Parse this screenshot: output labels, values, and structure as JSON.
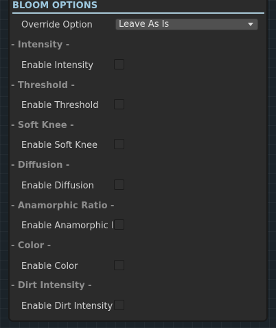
{
  "header": {
    "title": "BLOOM OPTIONS"
  },
  "override": {
    "label": "Override Option",
    "value": "Leave As Is",
    "caret_icon": "caret-down-icon"
  },
  "sections": [
    {
      "title": "- Intensity -",
      "label": "Enable Intensity",
      "checked": false
    },
    {
      "title": "- Threshold -",
      "label": "Enable Threshold",
      "checked": false
    },
    {
      "title": "- Soft Knee -",
      "label": "Enable Soft Knee",
      "checked": false
    },
    {
      "title": "- Diffusion -",
      "label": "Enable Diffusion",
      "checked": false
    },
    {
      "title": "- Anamorphic Ratio -",
      "label": "Enable Anamorphic Ratio",
      "checked": false
    },
    {
      "title": "- Color -",
      "label": "Enable Color",
      "checked": false
    },
    {
      "title": "- Dirt Intensity -",
      "label": "Enable Dirt Intensity",
      "checked": false
    }
  ],
  "colors": {
    "accent": "#9ec9e0",
    "panel": "#2b2b2b",
    "background": "#1b2329"
  }
}
